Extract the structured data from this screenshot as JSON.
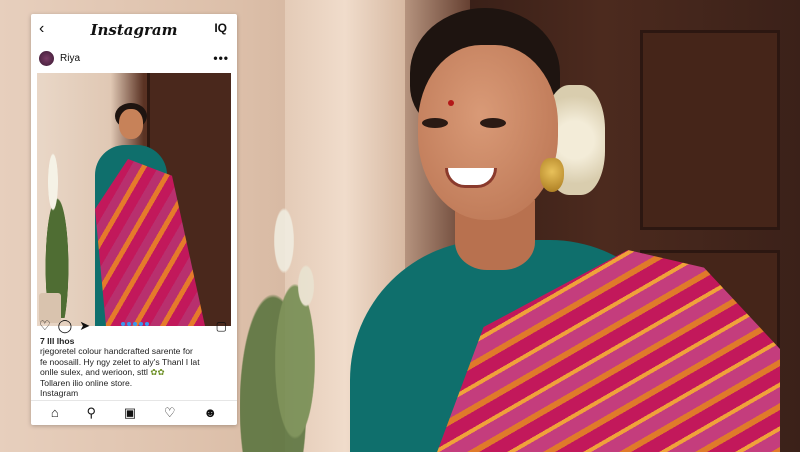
{
  "instagram": {
    "header": {
      "back_icon": "back-arrow-icon",
      "brand": "Instagram",
      "dm_label": "IQ"
    },
    "post": {
      "username": "Riya",
      "more_icon": "more-horizontal-icon",
      "likes": "7 lll lhos",
      "caption_lines": [
        "rjegoretel colour handcrafted sarente for",
        "fe noosaill. Hy ngy zelet to aly's Thanl I lat",
        "onlle sulex, and werioon, sttl",
        "Tollaren ilio online store."
      ],
      "tag": "Instagram"
    },
    "nav": {
      "home_icon": "home-icon",
      "search_icon": "search-icon",
      "reels_icon": "reels-icon",
      "activity_icon": "heart-icon",
      "profile_icon": "profile-icon"
    }
  }
}
